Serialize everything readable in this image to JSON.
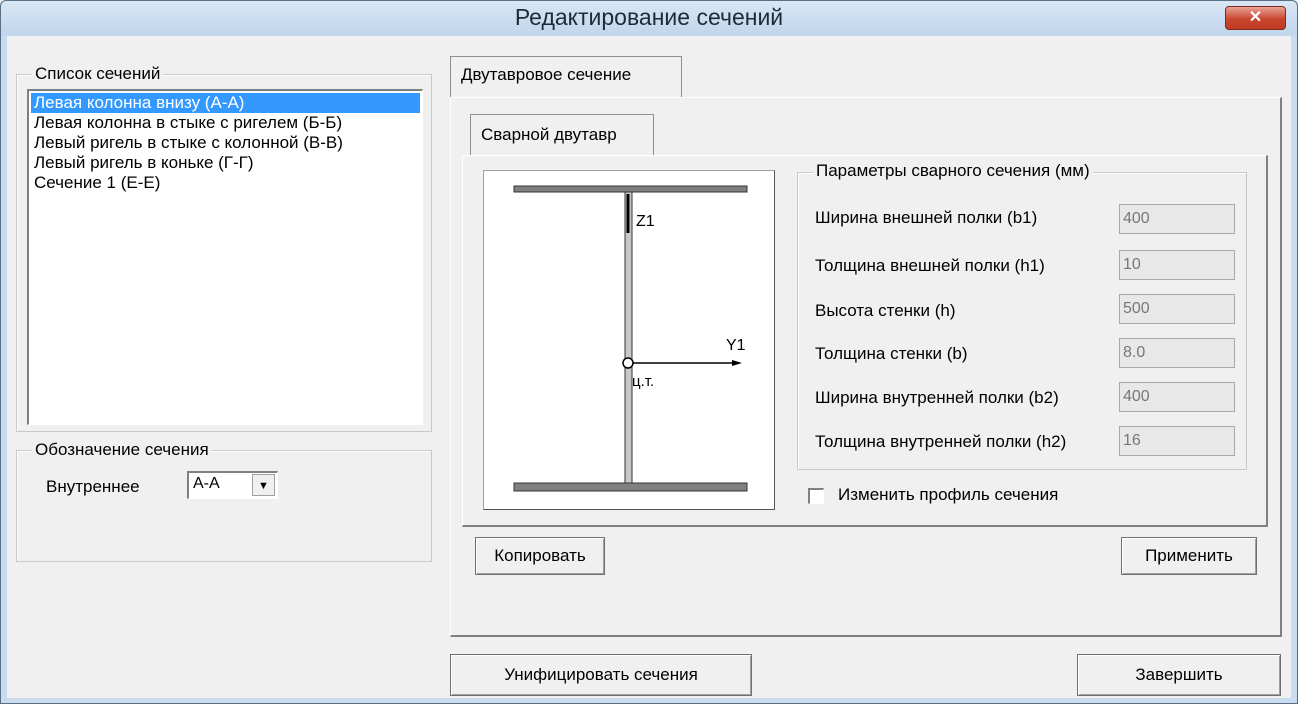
{
  "window": {
    "title": "Редактирование сечений",
    "close_label": "✕"
  },
  "sections_list": {
    "group_label": "Список сечений",
    "items": [
      "Левая колонна внизу (А-А)",
      "Левая колонна в стыке с ригелем (Б-Б)",
      "Левый ригель в стыке с колонной (В-В)",
      "Левый ригель в коньке (Г-Г)",
      "Сечение 1 (Е-Е)"
    ],
    "selected_index": 0
  },
  "designation": {
    "group_label": "Обозначение сечения",
    "label": "Внутреннее",
    "value": "А-А"
  },
  "tabs": {
    "outer": "Двутавровое сечение",
    "inner": "Сварной двутавр"
  },
  "diagram": {
    "z_label": "Z1",
    "y_label": "Y1",
    "cg_label": "ц.т."
  },
  "params": {
    "group_label": "Параметры сварного сечения (мм)",
    "rows": [
      {
        "label": "Ширина внешней полки (b1)",
        "value": "400"
      },
      {
        "label": "Толщина внешней полки (h1)",
        "value": "10"
      },
      {
        "label": "Высота стенки  (h)",
        "value": "500"
      },
      {
        "label": "Толщина стенки (b)",
        "value": "8.0"
      },
      {
        "label": "Ширина внутренней полки (b2)",
        "value": "400"
      },
      {
        "label": "Толщина внутренней полки (h2)",
        "value": "16"
      }
    ]
  },
  "checkbox": {
    "label": "Изменить профиль сечения",
    "checked": false
  },
  "buttons": {
    "copy": "Копировать",
    "apply": "Применить",
    "unify": "Унифицировать сечения",
    "finish": "Завершить"
  }
}
